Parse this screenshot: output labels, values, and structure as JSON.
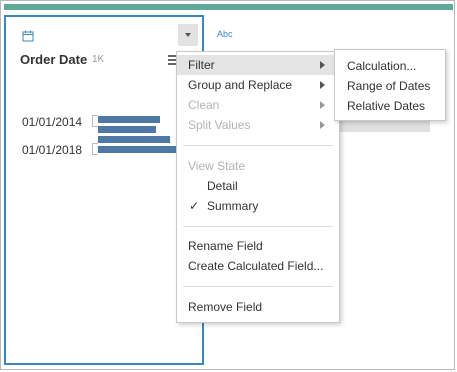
{
  "field_card": {
    "type_icon": "calendar-icon",
    "title": "Order Date",
    "count": "1K",
    "dropdown_icon": "chevron-down-icon",
    "sort_icon": "sort-lines-icon",
    "values": [
      {
        "label": "01/01/2014"
      },
      {
        "label": "01/01/2018"
      }
    ]
  },
  "second_column": {
    "type_label": "Abc"
  },
  "context_menu": {
    "filter": "Filter",
    "group_and_replace": "Group and Replace",
    "clean": "Clean",
    "split_values": "Split Values",
    "view_state_header": "View State",
    "detail": "Detail",
    "summary": "Summary",
    "summary_check": "✓",
    "rename_field": "Rename Field",
    "create_calculated_field": "Create Calculated Field...",
    "remove_field": "Remove Field"
  },
  "filter_submenu": {
    "calculation": "Calculation...",
    "range_of_dates": "Range of Dates",
    "relative_dates": "Relative Dates"
  },
  "colors": {
    "accent": "#5fa89a",
    "selection_border": "#3b87c5",
    "bar": "#4e79a7"
  }
}
